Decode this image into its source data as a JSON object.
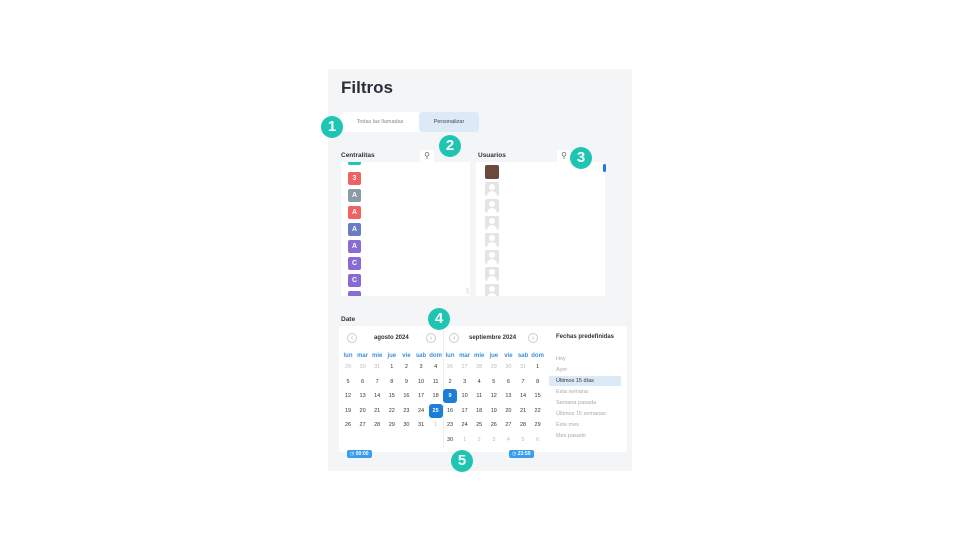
{
  "page": {
    "title": "Filtros"
  },
  "tabs": [
    {
      "label": "Todas las llamadas"
    },
    {
      "label": "Personalizar"
    }
  ],
  "badges": [
    "1",
    "2",
    "3",
    "4",
    "5"
  ],
  "centralitas": {
    "label": "Centralitas",
    "items": [
      {
        "letter": "",
        "color": "#1fc5b3"
      },
      {
        "letter": "3",
        "color": "#f06262"
      },
      {
        "letter": "A",
        "color": "#8a9aa6"
      },
      {
        "letter": "A",
        "color": "#f06262"
      },
      {
        "letter": "A",
        "color": "#6b7bc4"
      },
      {
        "letter": "A",
        "color": "#8a6bd1"
      },
      {
        "letter": "C",
        "color": "#8a6bd1"
      },
      {
        "letter": "C",
        "color": "#8a6bd1"
      },
      {
        "letter": "",
        "color": "#8a6bd1"
      }
    ]
  },
  "usuarios": {
    "label": "Usuarios",
    "items": [
      {
        "type": "photo"
      },
      {
        "type": "placeholder"
      },
      {
        "type": "placeholder"
      },
      {
        "type": "placeholder"
      },
      {
        "type": "placeholder"
      },
      {
        "type": "placeholder"
      },
      {
        "type": "placeholder"
      },
      {
        "type": "placeholder"
      },
      {
        "type": "photo2"
      }
    ]
  },
  "date": {
    "label": "Date",
    "left_month": {
      "title": "agosto 2024",
      "dow": [
        "lun",
        "mar",
        "mie",
        "jue",
        "vie",
        "sab",
        "dom"
      ],
      "weeks": [
        [
          "29",
          "30",
          "31",
          "1",
          "2",
          "3",
          "4"
        ],
        [
          "5",
          "6",
          "7",
          "8",
          "9",
          "10",
          "11"
        ],
        [
          "12",
          "13",
          "14",
          "15",
          "16",
          "17",
          "18"
        ],
        [
          "19",
          "20",
          "21",
          "22",
          "23",
          "24",
          "25"
        ],
        [
          "26",
          "27",
          "28",
          "29",
          "30",
          "31",
          "1"
        ]
      ],
      "selected": "25"
    },
    "right_month": {
      "title": "septiembre 2024",
      "dow": [
        "lun",
        "mar",
        "mie",
        "jue",
        "vie",
        "sab",
        "dom"
      ],
      "weeks": [
        [
          "26",
          "27",
          "28",
          "29",
          "30",
          "31",
          "1"
        ],
        [
          "2",
          "3",
          "4",
          "5",
          "6",
          "7",
          "8"
        ],
        [
          "9",
          "10",
          "11",
          "12",
          "13",
          "14",
          "15"
        ],
        [
          "16",
          "17",
          "18",
          "19",
          "20",
          "21",
          "22"
        ],
        [
          "23",
          "24",
          "25",
          "26",
          "27",
          "28",
          "29"
        ],
        [
          "30",
          "1",
          "2",
          "3",
          "4",
          "5",
          "6"
        ]
      ],
      "selected": "9"
    },
    "start_time": "00:00",
    "end_time": "23:59",
    "presets_title": "Fechas predefinidas",
    "presets": [
      {
        "label": "Hoy",
        "active": false
      },
      {
        "label": "Ayer",
        "active": false
      },
      {
        "label": "Últimos 15 días",
        "active": true
      },
      {
        "label": "Esta semana",
        "active": false
      },
      {
        "label": "Semana pasada",
        "active": false
      },
      {
        "label": "Últimos 15 semanas",
        "active": false
      },
      {
        "label": "Este mes",
        "active": false
      },
      {
        "label": "Mes pasado",
        "active": false
      }
    ]
  },
  "colors": {
    "accent": "#1d7ed8",
    "badge": "#1fc5b3",
    "panel": "#f4f5f7"
  }
}
